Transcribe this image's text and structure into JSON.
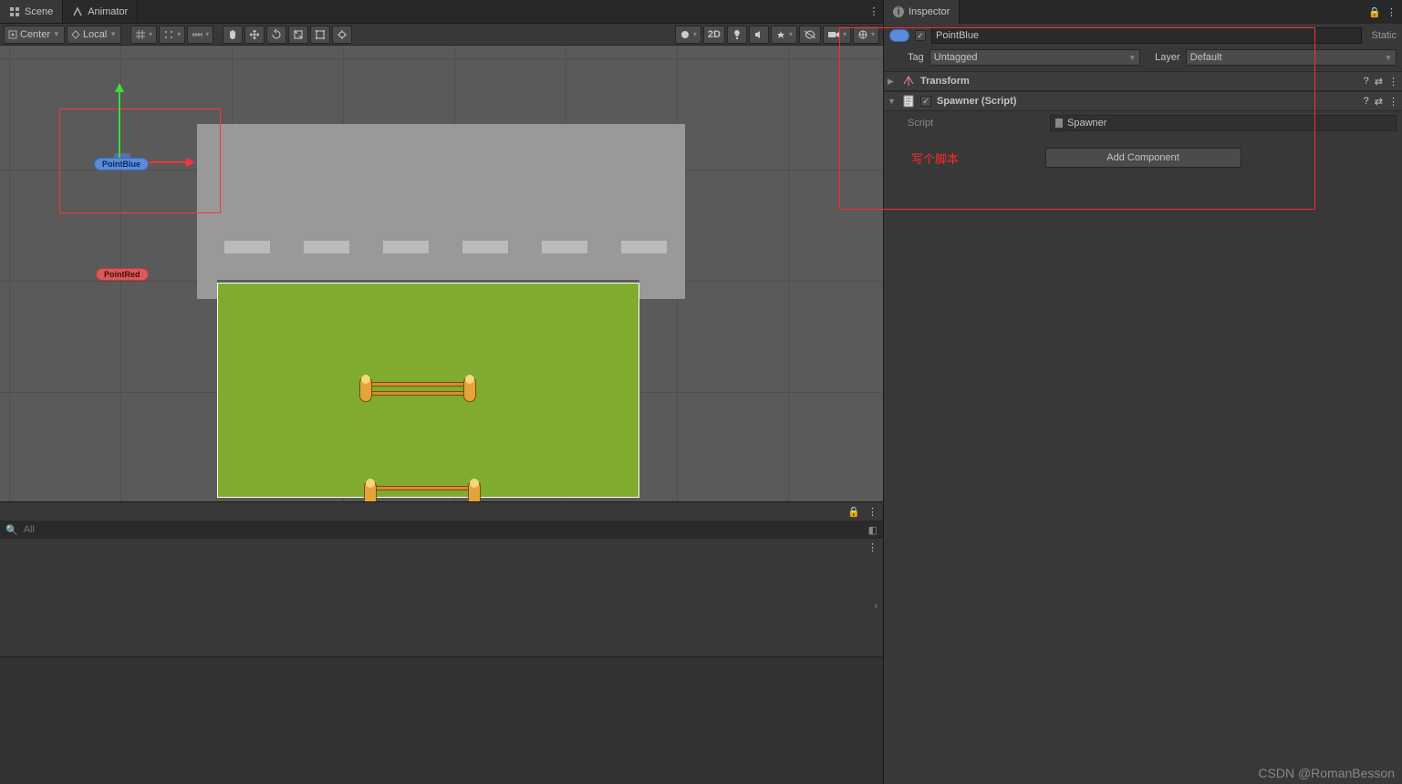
{
  "tabs": {
    "scene": "Scene",
    "animator": "Animator",
    "inspector": "Inspector"
  },
  "toolbar": {
    "pivot": "Center",
    "space": "Local",
    "mode2d": "2D"
  },
  "scene": {
    "pointBlue": "PointBlue",
    "pointRed": "PointRed"
  },
  "search": {
    "placeholder": "All"
  },
  "inspector": {
    "objectName": "PointBlue",
    "staticLabel": "Static",
    "tagLabel": "Tag",
    "tagValue": "Untagged",
    "layerLabel": "Layer",
    "layerValue": "Default",
    "components": {
      "transform": "Transform",
      "spawner": "Spawner (Script)",
      "scriptField": "Script",
      "scriptValue": "Spawner"
    },
    "addComponent": "Add Component",
    "annotation": "写个脚本"
  },
  "watermark": "CSDN @RomanBesson"
}
